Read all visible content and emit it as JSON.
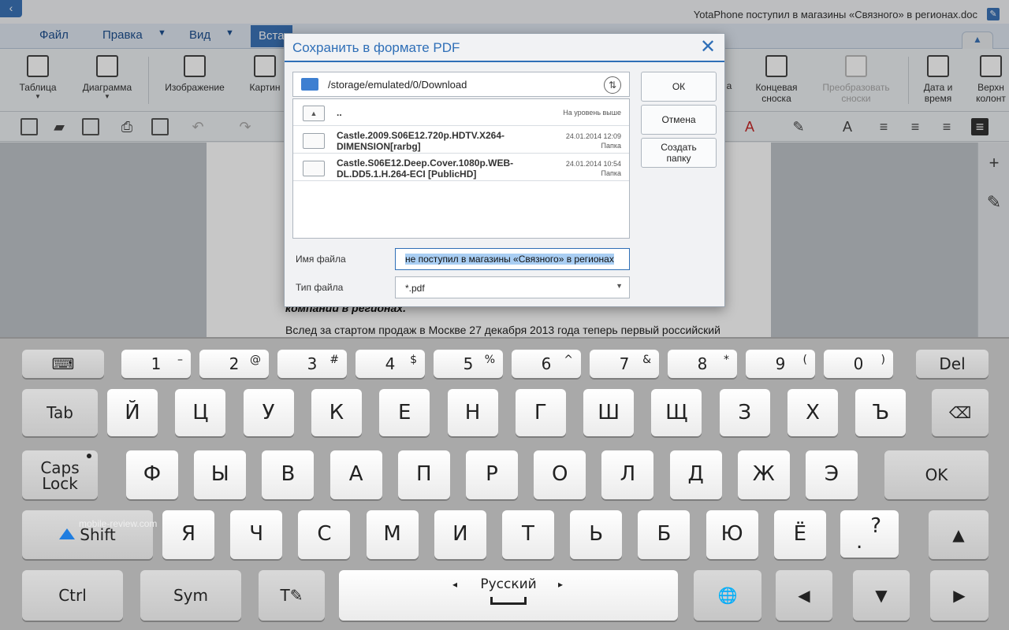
{
  "titlebar": {
    "doc_title": "YotaPhone поступил в магазины «Связного» в регионах.doc",
    "back_glyph": "‹",
    "edit_glyph": "✎"
  },
  "menu": {
    "file": "Файл",
    "edit": "Правка",
    "view": "Вид",
    "insert": "Вста"
  },
  "ribbon": {
    "table": "Таблица",
    "chart": "Диаграмма",
    "image": "Изображение",
    "picture": "Картин",
    "notes": "а",
    "endnote": "Концевая сноска",
    "convert_notes": "Преобразовать сноски",
    "date_time": "Дата и время",
    "header": "Верхн колонт"
  },
  "document": {
    "heading": "компании в регионах.",
    "body": "Вслед за стартом продаж в Москве 27 декабря 2013 года теперь первый российский"
  },
  "dialog": {
    "title": "Сохранить в формате PDF",
    "close_glyph": "✕",
    "path": "/storage/emulated/0/Download",
    "sort_glyph": "⇅",
    "files": [
      {
        "name": "..",
        "meta": "На уровень выше"
      },
      {
        "name": "Castle.2009.S06E12.720p.HDTV.X264-DIMENSION[rarbg]",
        "date": "24.01.2014 12:09",
        "kind": "Папка"
      },
      {
        "name": "Castle.S06E12.Deep.Cover.1080p.WEB-DL.DD5.1.H.264-ECI [PublicHD]",
        "date": "24.01.2014 10:54",
        "kind": "Папка"
      }
    ],
    "ok": "ОК",
    "cancel": "Отмена",
    "create_folder": "Создать папку",
    "filename_label": "Имя файла",
    "filename_value": "не поступил в магазины «Связного» в регионах",
    "filetype_label": "Тип файла",
    "filetype_value": "*.pdf",
    "select_arrow": "▼"
  },
  "keyboard": {
    "numbers": [
      {
        "main": "1",
        "sub": "–"
      },
      {
        "main": "2",
        "sub": "@"
      },
      {
        "main": "3",
        "sub": "#"
      },
      {
        "main": "4",
        "sub": "$"
      },
      {
        "main": "5",
        "sub": "%"
      },
      {
        "main": "6",
        "sub": "^"
      },
      {
        "main": "7",
        "sub": "&"
      },
      {
        "main": "8",
        "sub": "*"
      },
      {
        "main": "9",
        "sub": "("
      },
      {
        "main": "0",
        "sub": ")"
      }
    ],
    "row1": [
      "Й",
      "Ц",
      "У",
      "К",
      "Е",
      "Н",
      "Г",
      "Ш",
      "Щ",
      "З",
      "Х",
      "Ъ"
    ],
    "row2": [
      "Ф",
      "Ы",
      "В",
      "А",
      "П",
      "Р",
      "О",
      "Л",
      "Д",
      "Ж",
      "Э"
    ],
    "row3": [
      "Я",
      "Ч",
      "С",
      "М",
      "И",
      "Т",
      "Ь",
      "Б",
      "Ю",
      "Ё"
    ],
    "punct": "?",
    "punct_dot": ".",
    "del": "Del",
    "tab": "Tab",
    "caps": "Caps Lock",
    "ok": "OK",
    "shift": "Shift",
    "ctrl": "Ctrl",
    "sym": "Sym",
    "language": "Русский",
    "arrow_up": "▲",
    "arrow_left": "◀",
    "arrow_down": "▼",
    "arrow_right": "▶",
    "globe_glyph": "🌐",
    "backspace_glyph": "⌫",
    "hide_glyph": "⌨",
    "lang_left": "◂",
    "lang_right": "▸",
    "text_tool_glyph": "T✎"
  },
  "watermark": "mobile-review.com"
}
